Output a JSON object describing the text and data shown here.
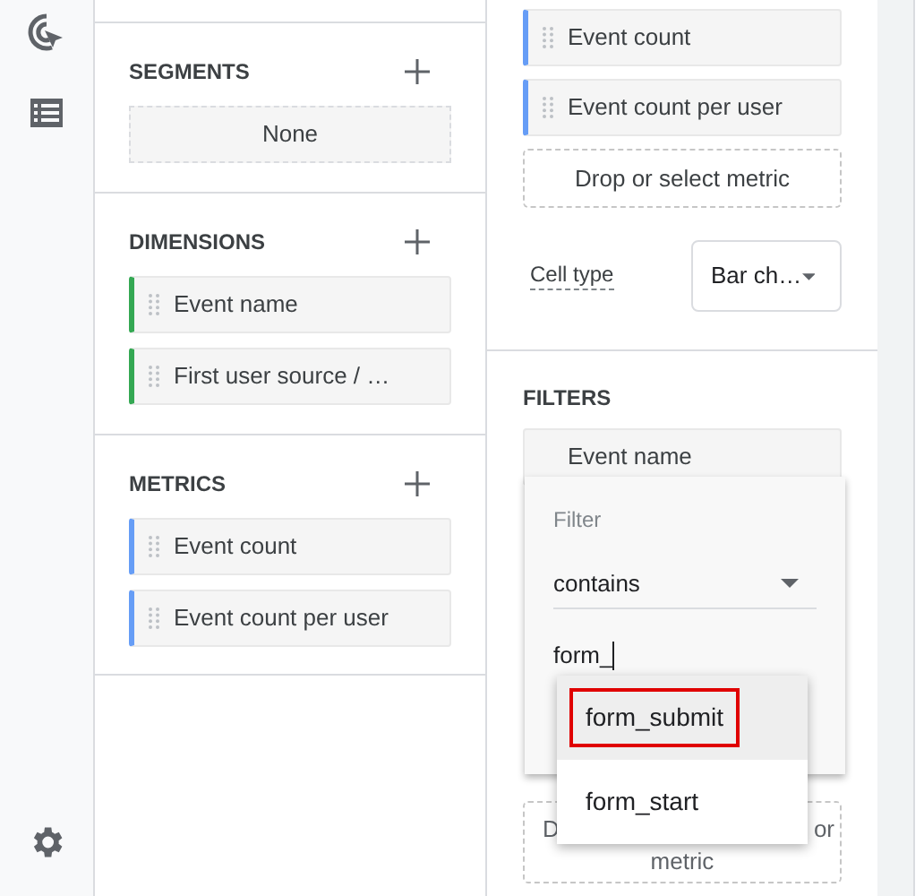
{
  "segments": {
    "title": "SEGMENTS",
    "items": [
      "None"
    ]
  },
  "dimensions": {
    "title": "DIMENSIONS",
    "items": [
      "Event name",
      "First user source / …"
    ]
  },
  "metrics": {
    "title": "METRICS",
    "items": [
      "Event count",
      "Event count per user"
    ]
  },
  "values": {
    "items": [
      "Event count",
      "Event count per user"
    ],
    "drop_target": "Drop or select metric"
  },
  "cell_type": {
    "label": "Cell type",
    "value": "Bar ch…"
  },
  "filters": {
    "title": "FILTERS",
    "chip": "Event name",
    "popup": {
      "label": "Filter",
      "condition": "contains",
      "input_value": "form_",
      "suggestions": [
        {
          "label": "form_submit",
          "selected": true,
          "outlined": true
        },
        {
          "label": "form_start",
          "selected": false,
          "outlined": false
        }
      ]
    },
    "covered_drop_target": {
      "left_part": "D",
      "right_part": "or",
      "second_line": "metric"
    }
  }
}
